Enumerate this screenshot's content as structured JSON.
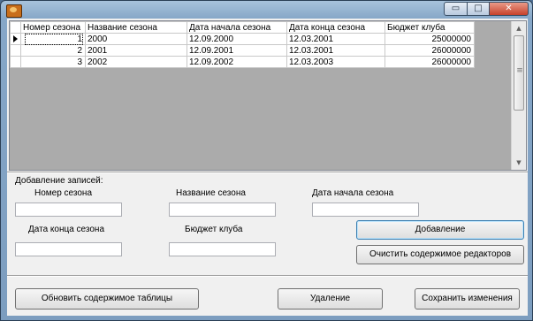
{
  "window": {
    "title": "",
    "controls": {
      "minimize": "▭",
      "maximize": "□",
      "close": "✕"
    }
  },
  "grid": {
    "columns": [
      "Номер сезона",
      "Название сезона",
      "Дата начала сезона",
      "Дата конца сезона",
      "Бюджет клуба"
    ],
    "rows": [
      {
        "number": "1",
        "name": "2000",
        "start": "12.09.2000",
        "end": "12.03.2001",
        "budget": "25000000",
        "current": true
      },
      {
        "number": "2",
        "name": "2001",
        "start": "12.09.2001",
        "end": "12.03.2001",
        "budget": "26000000",
        "current": false
      },
      {
        "number": "3",
        "name": "2002",
        "start": "12.09.2002",
        "end": "12.03.2003",
        "budget": "26000000",
        "current": false
      }
    ],
    "scroll": {
      "up": "▲",
      "down": "▼"
    }
  },
  "form": {
    "group_label": "Добавление записей:",
    "season_number_label": "Номер сезона",
    "season_number_value": "",
    "season_name_label": "Название сезона",
    "season_name_value": "",
    "start_date_label": "Дата начала сезона",
    "start_date_value": "",
    "end_date_label": "Дата конца сезона",
    "end_date_value": "",
    "budget_label": "Бюджет клуба",
    "budget_value": "",
    "add_button": "Добавление",
    "clear_button": "Очистить содержимое редакторов"
  },
  "actions": {
    "refresh_button": "Обновить содержимое таблицы",
    "delete_button": "Удаление",
    "save_button": "Сохранить изменения"
  },
  "colors": {
    "titlebar": "#86a7c8",
    "close_button": "#c7412b",
    "grid_background": "#ababab",
    "default_button_border": "#3c7fb1"
  }
}
